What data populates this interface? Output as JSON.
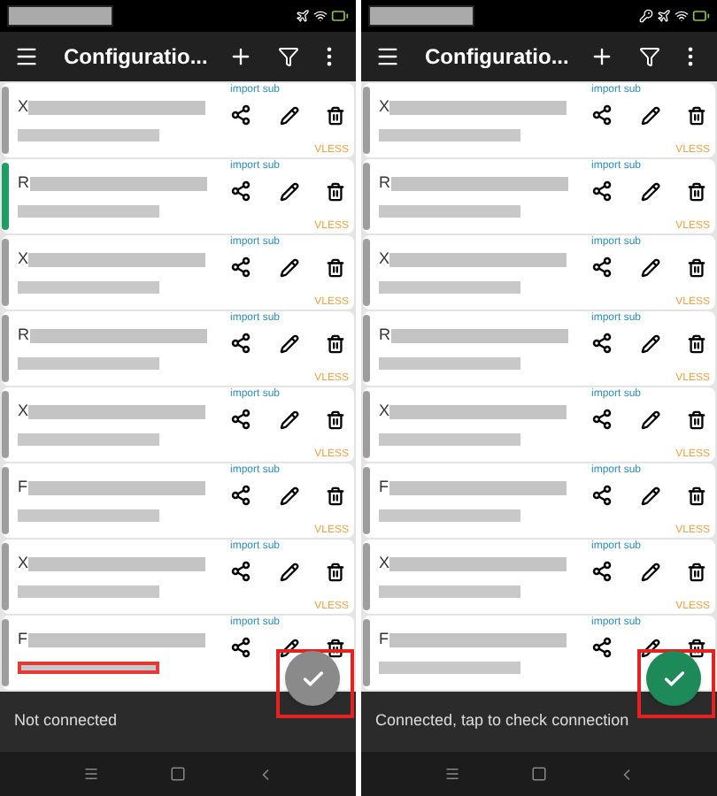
{
  "panels": [
    {
      "status_icons": [
        {
          "kind": "airplane"
        },
        {
          "kind": "wifi"
        },
        {
          "kind": "battery"
        }
      ],
      "title": "Configuratio...",
      "servers": [
        {
          "initial": "X",
          "selected": false,
          "underlined": false,
          "source": "import sub",
          "protocol": "VLESS"
        },
        {
          "initial": "R",
          "selected": true,
          "underlined": false,
          "source": "import sub",
          "protocol": "VLESS"
        },
        {
          "initial": "X",
          "selected": false,
          "underlined": false,
          "source": "import sub",
          "protocol": "VLESS"
        },
        {
          "initial": "R",
          "selected": false,
          "underlined": false,
          "source": "import sub",
          "protocol": "VLESS"
        },
        {
          "initial": "X",
          "selected": false,
          "underlined": false,
          "source": "import sub",
          "protocol": "VLESS"
        },
        {
          "initial": "F",
          "selected": false,
          "underlined": false,
          "source": "import sub",
          "protocol": "VLESS"
        },
        {
          "initial": "X",
          "selected": false,
          "underlined": false,
          "source": "import sub",
          "protocol": "VLESS"
        },
        {
          "initial": "F",
          "selected": false,
          "underlined": true,
          "source": "import sub"
        }
      ],
      "connected": false,
      "status": "Not connected"
    },
    {
      "status_icons": [
        {
          "kind": "key"
        },
        {
          "kind": "airplane"
        },
        {
          "kind": "wifi"
        },
        {
          "kind": "battery"
        }
      ],
      "title": "Configuratio...",
      "servers": [
        {
          "initial": "X",
          "selected": false,
          "underlined": false,
          "source": "import sub",
          "protocol": "VLESS"
        },
        {
          "initial": "R",
          "selected": false,
          "underlined": false,
          "source": "import sub",
          "protocol": "VLESS"
        },
        {
          "initial": "X",
          "selected": false,
          "underlined": false,
          "source": "import sub",
          "protocol": "VLESS"
        },
        {
          "initial": "R",
          "selected": false,
          "underlined": false,
          "source": "import sub",
          "protocol": "VLESS"
        },
        {
          "initial": "X",
          "selected": false,
          "underlined": false,
          "source": "import sub",
          "protocol": "VLESS"
        },
        {
          "initial": "F",
          "selected": false,
          "underlined": false,
          "source": "import sub",
          "protocol": "VLESS"
        },
        {
          "initial": "X",
          "selected": false,
          "underlined": false,
          "source": "import sub",
          "protocol": "VLESS"
        },
        {
          "initial": "F",
          "selected": false,
          "underlined": false,
          "source": "import sub"
        }
      ],
      "connected": true,
      "status": "Connected, tap to check connection"
    }
  ]
}
